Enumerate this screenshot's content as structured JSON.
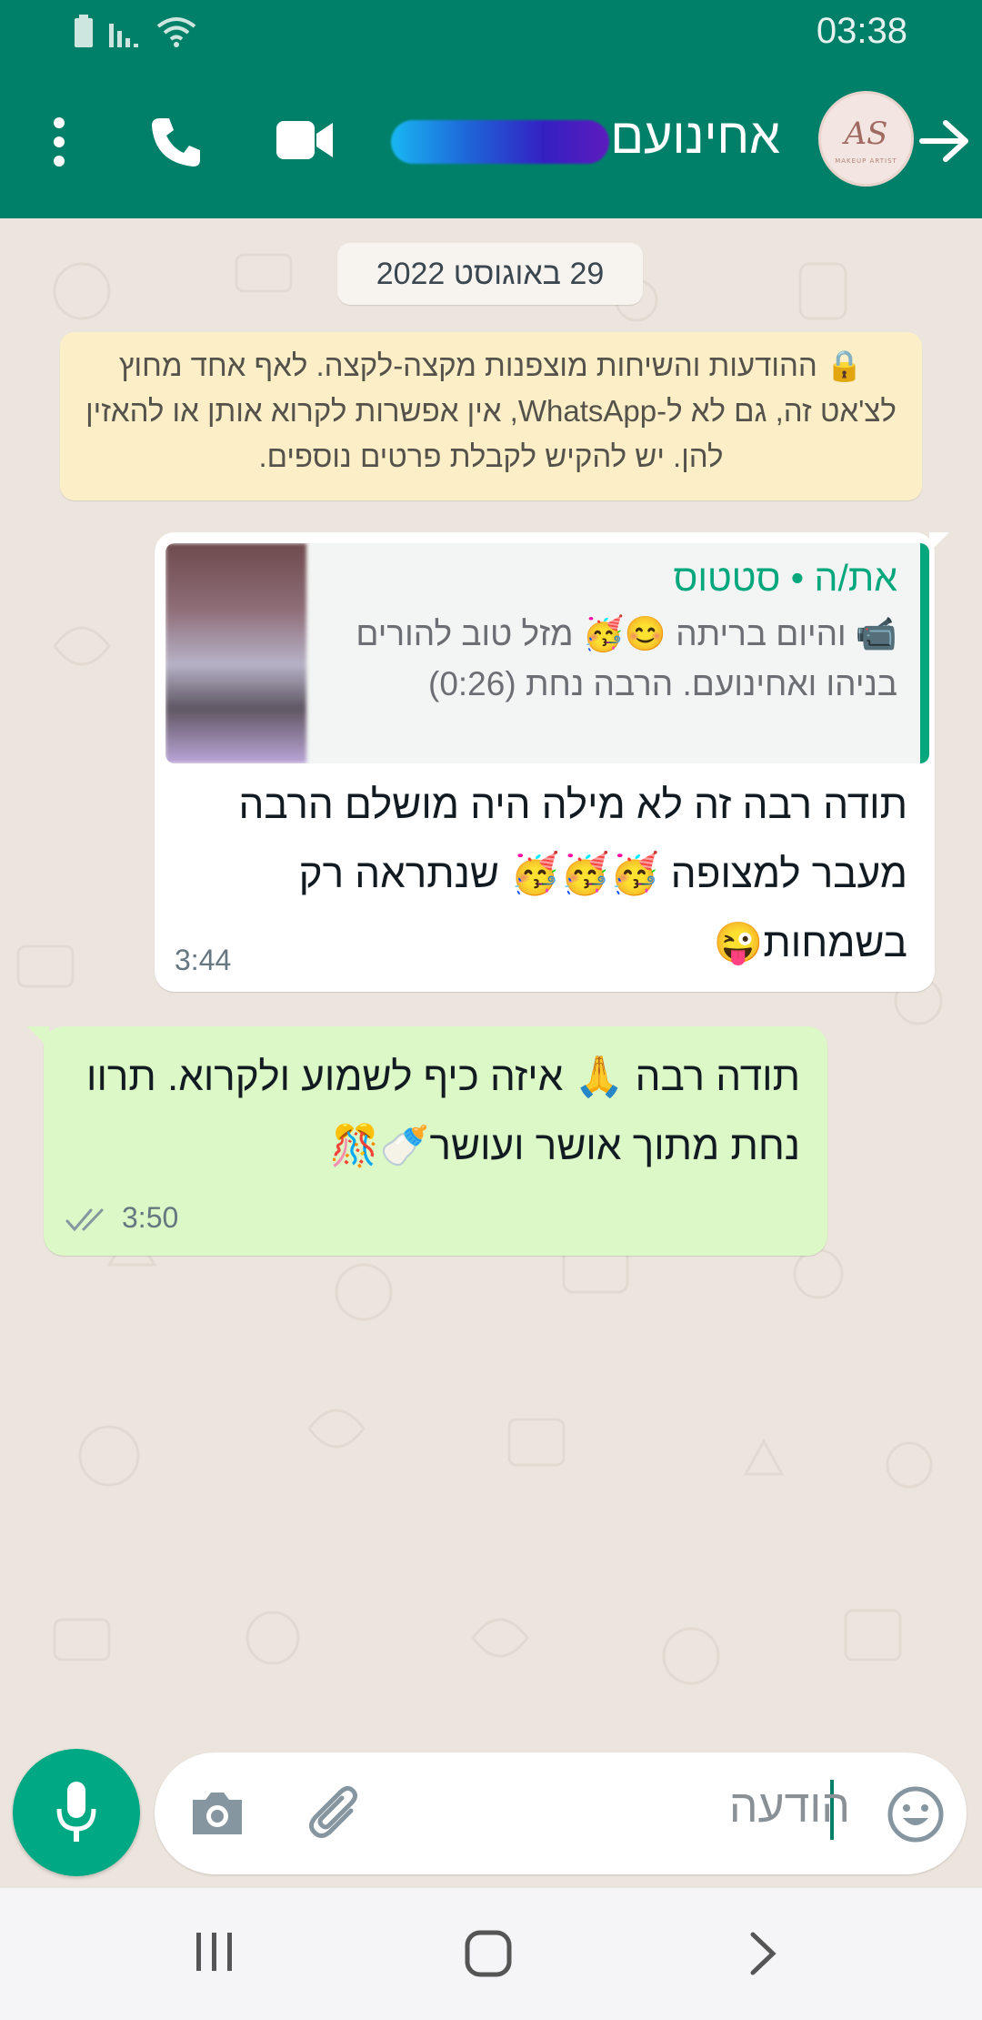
{
  "status_bar": {
    "time": "03:38"
  },
  "header": {
    "contact_name": "אחינועם",
    "avatar_text": "AS",
    "avatar_subtext": "MAKEUP ARTIST"
  },
  "chat": {
    "date_chip": "29 באוגוסט 2022",
    "encryption_notice": "🔒 ההודעות והשיחות מוצפנות מקצה-לקצה. לאף אחד מחוץ לצ'אט זה, גם לא ל-WhatsApp, אין אפשרות לקרוא אותן או להאזין להן. יש להקיש לקבלת פרטים נוספים.",
    "incoming": {
      "quote_sender": "את/ה • סטטוס",
      "quote_text": "📹 והיום בריתה 😊🥳 מזל טוב להורים בניהו ואחינועם. הרבה נחת (0:26)",
      "text": "תודה רבה זה לא מילה היה מושלם הרבה מעבר למצופה 🥳🥳🥳 שנתראה רק בשמחות😜",
      "time": "3:44"
    },
    "outgoing": {
      "text": "תודה רבה 🙏 איזה כיף לשמוע ולקרוא. תרוו נחת מתוך אושר ועושר🍼🎊",
      "time": "3:50",
      "status": "read"
    }
  },
  "input": {
    "placeholder": "הודעה"
  },
  "colors": {
    "header": "#008069",
    "outgoing_bubble": "#dcf8c6",
    "incoming_bubble": "#ffffff",
    "mic_button": "#00a884",
    "notice": "#fcefc7"
  }
}
